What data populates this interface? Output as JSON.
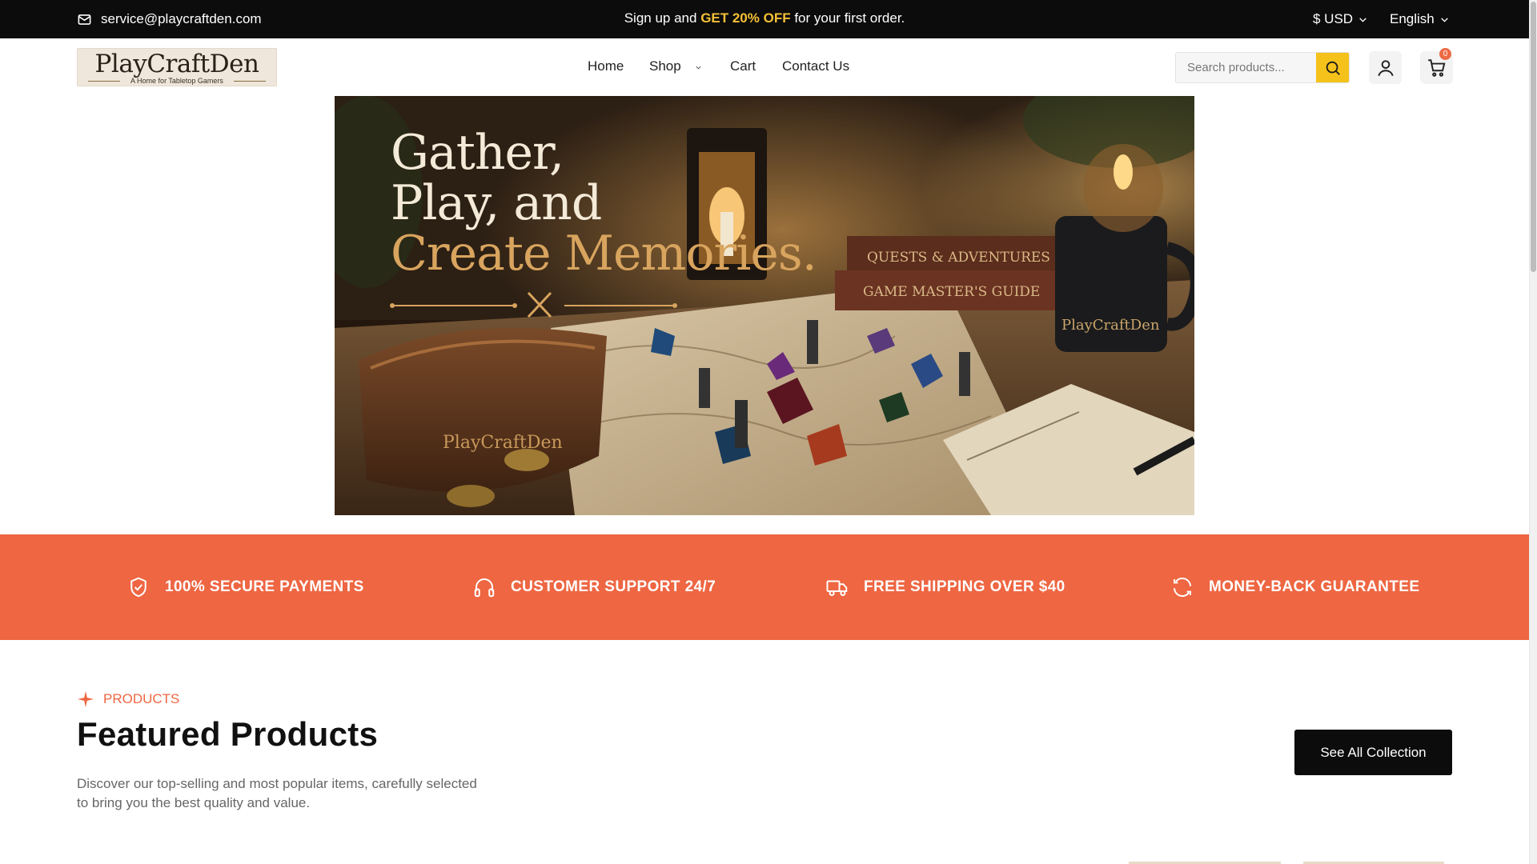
{
  "topbar": {
    "email": "service@playcraftden.com",
    "promo_before": "Sign up and ",
    "promo_highlight": "GET 20% OFF",
    "promo_after": " for your first order.",
    "currency": "$ USD",
    "language": "English"
  },
  "header": {
    "logo_title": "PlayCraftDen",
    "logo_tagline": "A Home for Tabletop Gamers",
    "nav": [
      "Home",
      "Shop",
      "Cart",
      "Contact Us"
    ],
    "search_placeholder": "Search products...",
    "cart_count": "0"
  },
  "hero": {
    "line1": "Gather,",
    "line2": "Play, and",
    "line3": "Create Memories.",
    "book1": "QUESTS & ADVENTURES",
    "book2": "GAME MASTER'S GUIDE",
    "brand": "PlayCraftDen"
  },
  "features": [
    {
      "icon": "shield-check-icon",
      "label": "100% SECURE PAYMENTS"
    },
    {
      "icon": "headphones-icon",
      "label": "CUSTOMER SUPPORT 24/7"
    },
    {
      "icon": "truck-icon",
      "label": "FREE SHIPPING OVER $40"
    },
    {
      "icon": "refresh-icon",
      "label": "MONEY-BACK GUARANTEE"
    }
  ],
  "products_section": {
    "tag": "PRODUCTS",
    "title": "Featured Products",
    "description_line1": "Discover our top-selling and most popular items, carefully selected",
    "description_line2": "to bring you the best quality and value.",
    "cta": "See All Collection"
  },
  "colors": {
    "accent": "#ee6642",
    "highlight": "#f5c137",
    "search_button": "#f5c21b",
    "dark": "#0c0c0c"
  }
}
